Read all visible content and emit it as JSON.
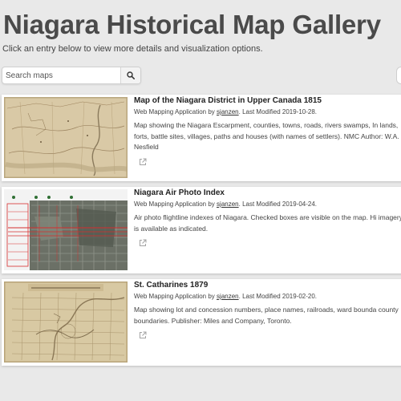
{
  "header": {
    "title": "Niagara Historical Map Gallery",
    "subtitle": "Click an entry below to view more details and visualization options."
  },
  "search": {
    "placeholder": "Search maps",
    "button_icon": "search-icon"
  },
  "entries": [
    {
      "title": "Map of the Niagara District in Upper Canada 1815",
      "type_label": "Web Mapping Application by",
      "owner": "sjanzen",
      "modified_label": ". Last Modified 2019-10-28.",
      "snippet": "Map showing the Niagara Escarpment, counties, towns, roads, rivers swamps, In lands, forts, battle sites, villages, paths and houses (with names of settlers). NMC Author: W.A. Nesfield",
      "link_icon": "external-link-icon"
    },
    {
      "title": "Niagara Air Photo Index",
      "type_label": "Web Mapping Application by",
      "owner": "sjanzen",
      "modified_label": ". Last Modified 2019-04-24.",
      "snippet": "Air photo flightline indexes of Niagara. Checked boxes are visible on the map. Hi imagery is available as indicated.",
      "link_icon": "external-link-icon"
    },
    {
      "title": "St. Catharines 1879",
      "type_label": "Web Mapping Application by",
      "owner": "sjanzen",
      "modified_label": ". Last Modified 2019-02-20.",
      "snippet": "Map showing lot and concession numbers, place names, railroads, ward bounda county boundaries. Publisher: Miles and Company, Toronto.",
      "link_icon": "external-link-icon"
    }
  ]
}
